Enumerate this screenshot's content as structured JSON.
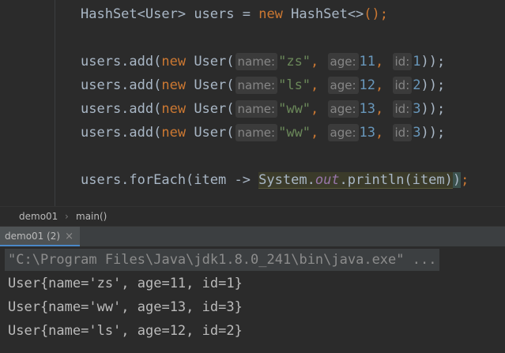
{
  "editor": {
    "line1": {
      "type1": "HashSet",
      "gen1": "<User>",
      "var": " users = ",
      "kw_new": "new",
      "type2": " HashSet",
      "gen2": "<>",
      "end": "();"
    },
    "adds": [
      {
        "prefix": "users.add(",
        "kw": "new",
        "cls": " User(",
        "hint_name": "name:",
        "name": "\"zs\"",
        "hint_age": "age:",
        "age": "11",
        "hint_id": "id:",
        "id": "1",
        "end": "));"
      },
      {
        "prefix": "users.add(",
        "kw": "new",
        "cls": " User(",
        "hint_name": "name:",
        "name": "\"ls\"",
        "hint_age": "age:",
        "age": "12",
        "hint_id": "id:",
        "id": "2",
        "end": "));"
      },
      {
        "prefix": "users.add(",
        "kw": "new",
        "cls": " User(",
        "hint_name": "name:",
        "name": "\"ww\"",
        "hint_age": "age:",
        "age": "13",
        "hint_id": "id:",
        "id": "3",
        "end": "));"
      },
      {
        "prefix": "users.add(",
        "kw": "new",
        "cls": " User(",
        "hint_name": "name:",
        "name": "\"ww\"",
        "hint_age": "age:",
        "age": "13",
        "hint_id": "id:",
        "id": "3",
        "end": "));"
      }
    ],
    "foreach": {
      "prefix": "users.forEach(item -> ",
      "system": "System.",
      "out": "out",
      "rest": ".println(item)",
      "close": ")",
      "semi": ";"
    }
  },
  "breadcrumb": {
    "class": "demo01",
    "sep": "›",
    "method": "main()"
  },
  "run_tab": {
    "label": "demo01 (2)",
    "close": "×"
  },
  "console": {
    "command": "\"C:\\Program Files\\Java\\jdk1.8.0_241\\bin\\java.exe\" ...",
    "output": [
      "User{name='zs', age=11, id=1}",
      "User{name='ww', age=13, id=3}",
      "User{name='ls', age=12, id=2}"
    ]
  }
}
